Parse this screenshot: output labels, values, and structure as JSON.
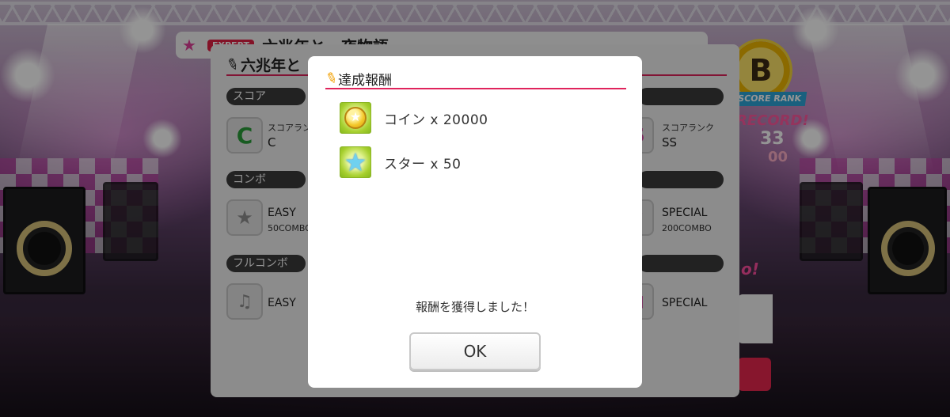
{
  "background_results": {
    "song_title": "六兆年と一夜物語",
    "level_badge": "EXPERT",
    "modal_title": "六兆年と",
    "score_rank_badge": "B",
    "score_rank_ribbon": "SCORE RANK",
    "side_record": "RECORD!",
    "side_score_1": "33",
    "side_score_2": "00",
    "sections": {
      "score": "スコア",
      "combo": "コンボ",
      "full_combo": "フルコンボ"
    },
    "score_left": {
      "label": "スコアランク",
      "value": "C",
      "icon_letter": "C"
    },
    "score_right": {
      "label": "スコアランク",
      "value": "SS",
      "icon_letter": "S"
    },
    "combo_left": {
      "label": "EASY",
      "sub": "50COMBO"
    },
    "combo_right": {
      "label": "SPECIAL",
      "sub": "200COMBO"
    },
    "fullcombo_left": {
      "label": "EASY"
    },
    "fullcombo_right": {
      "label": "SPECIAL"
    }
  },
  "dialog": {
    "title": "達成報酬",
    "rewards": [
      {
        "icon": "coin-icon",
        "label": "コイン x 20000"
      },
      {
        "icon": "star-icon",
        "label": "スター x 50"
      }
    ],
    "message": "報酬を獲得しました！",
    "ok_label": "OK"
  },
  "colors": {
    "accent_line": "#e0245c",
    "dialog_bg": "#ffffff",
    "overlay": "rgba(0,0,0,0.42)",
    "reward_tile": "#a6cf2e"
  }
}
